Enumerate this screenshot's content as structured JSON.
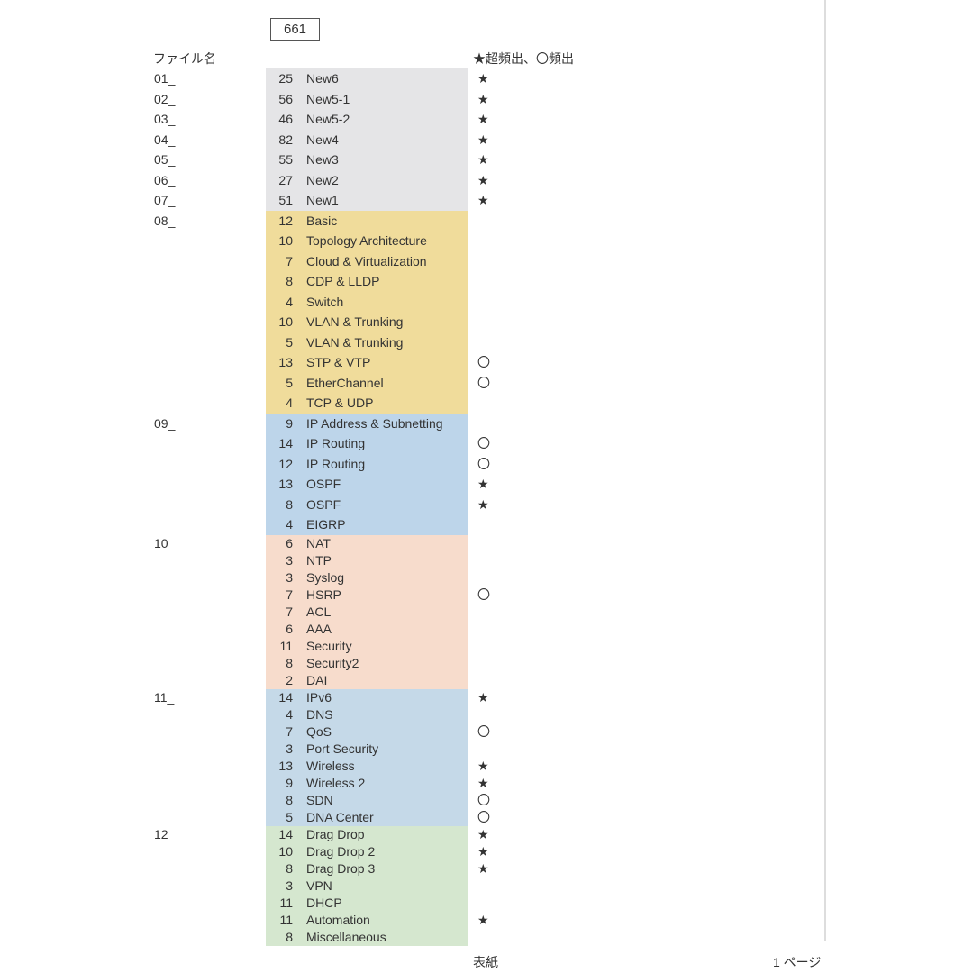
{
  "total": "661",
  "header": {
    "file": "ファイル名",
    "legend": "★超頻出、〇頻出"
  },
  "footer": {
    "center": "表紙",
    "right": "1 ページ"
  },
  "rows": [
    {
      "file": "01_",
      "count": 25,
      "topic": "New6",
      "mark": "★",
      "bg": "gray"
    },
    {
      "file": "02_",
      "count": 56,
      "topic": "New5-1",
      "mark": "★",
      "bg": "gray"
    },
    {
      "file": "03_",
      "count": 46,
      "topic": "New5-2",
      "mark": "★",
      "bg": "gray"
    },
    {
      "file": "04_",
      "count": 82,
      "topic": "New4",
      "mark": "★",
      "bg": "gray"
    },
    {
      "file": "05_",
      "count": 55,
      "topic": "New3",
      "mark": "★",
      "bg": "gray"
    },
    {
      "file": "06_",
      "count": 27,
      "topic": "New2",
      "mark": "★",
      "bg": "gray"
    },
    {
      "file": "07_",
      "count": 51,
      "topic": "New1",
      "mark": "★",
      "bg": "gray"
    },
    {
      "file": "08_",
      "count": 12,
      "topic": "Basic",
      "mark": "",
      "bg": "yellow"
    },
    {
      "file": "",
      "count": 10,
      "topic": "Topology Architecture",
      "mark": "",
      "bg": "yellow"
    },
    {
      "file": "",
      "count": 7,
      "topic": "Cloud & Virtualization",
      "mark": "",
      "bg": "yellow"
    },
    {
      "file": "",
      "count": 8,
      "topic": "CDP & LLDP",
      "mark": "",
      "bg": "yellow"
    },
    {
      "file": "",
      "count": 4,
      "topic": "Switch",
      "mark": "",
      "bg": "yellow"
    },
    {
      "file": "",
      "count": 10,
      "topic": "VLAN & Trunking",
      "mark": "",
      "bg": "yellow"
    },
    {
      "file": "",
      "count": 5,
      "topic": "VLAN & Trunking",
      "mark": "",
      "bg": "yellow"
    },
    {
      "file": "",
      "count": 13,
      "topic": "STP & VTP",
      "mark": "〇",
      "bg": "yellow"
    },
    {
      "file": "",
      "count": 5,
      "topic": "EtherChannel",
      "mark": "〇",
      "bg": "yellow"
    },
    {
      "file": "",
      "count": 4,
      "topic": "TCP & UDP",
      "mark": "",
      "bg": "yellow"
    },
    {
      "file": "09_",
      "count": 9,
      "topic": "IP Address & Subnetting",
      "mark": "",
      "bg": "blue"
    },
    {
      "file": "",
      "count": 14,
      "topic": "IP Routing",
      "mark": "〇",
      "bg": "blue"
    },
    {
      "file": "",
      "count": 12,
      "topic": "IP Routing",
      "mark": "〇",
      "bg": "blue"
    },
    {
      "file": "",
      "count": 13,
      "topic": "OSPF",
      "mark": "★",
      "bg": "blue"
    },
    {
      "file": "",
      "count": 8,
      "topic": "OSPF",
      "mark": "★",
      "bg": "blue"
    },
    {
      "file": "",
      "count": 4,
      "topic": "EIGRP",
      "mark": "",
      "bg": "blue"
    },
    {
      "file": "10_",
      "count": 6,
      "topic": "NAT",
      "mark": "",
      "bg": "peach",
      "compact": true
    },
    {
      "file": "",
      "count": 3,
      "topic": "NTP",
      "mark": "",
      "bg": "peach",
      "compact": true
    },
    {
      "file": "",
      "count": 3,
      "topic": "Syslog",
      "mark": "",
      "bg": "peach",
      "compact": true
    },
    {
      "file": "",
      "count": 7,
      "topic": "HSRP",
      "mark": "〇",
      "bg": "peach",
      "compact": true
    },
    {
      "file": "",
      "count": 7,
      "topic": "ACL",
      "mark": "",
      "bg": "peach",
      "compact": true
    },
    {
      "file": "",
      "count": 6,
      "topic": "AAA",
      "mark": "",
      "bg": "peach",
      "compact": true
    },
    {
      "file": "",
      "count": 11,
      "topic": "Security",
      "mark": "",
      "bg": "peach",
      "compact": true
    },
    {
      "file": "",
      "count": 8,
      "topic": "Security2",
      "mark": "",
      "bg": "peach",
      "compact": true
    },
    {
      "file": "",
      "count": 2,
      "topic": "DAI",
      "mark": "",
      "bg": "peach",
      "compact": true
    },
    {
      "file": "11_",
      "count": 14,
      "topic": "IPv6",
      "mark": "★",
      "bg": "blue2",
      "compact": true
    },
    {
      "file": "",
      "count": 4,
      "topic": "DNS",
      "mark": "",
      "bg": "blue2",
      "compact": true
    },
    {
      "file": "",
      "count": 7,
      "topic": "QoS",
      "mark": "〇",
      "bg": "blue2",
      "compact": true
    },
    {
      "file": "",
      "count": 3,
      "topic": "Port Security",
      "mark": "",
      "bg": "blue2",
      "compact": true
    },
    {
      "file": "",
      "count": 13,
      "topic": "Wireless",
      "mark": "★",
      "bg": "blue2",
      "compact": true
    },
    {
      "file": "",
      "count": 9,
      "topic": "Wireless 2",
      "mark": "★",
      "bg": "blue2",
      "compact": true
    },
    {
      "file": "",
      "count": 8,
      "topic": "SDN",
      "mark": "〇",
      "bg": "blue2",
      "compact": true
    },
    {
      "file": "",
      "count": 5,
      "topic": "DNA Center",
      "mark": "〇",
      "bg": "blue2",
      "compact": true
    },
    {
      "file": "12_",
      "count": 14,
      "topic": "Drag Drop",
      "mark": "★",
      "bg": "green",
      "compact": true
    },
    {
      "file": "",
      "count": 10,
      "topic": "Drag Drop 2",
      "mark": "★",
      "bg": "green",
      "compact": true
    },
    {
      "file": "",
      "count": 8,
      "topic": "Drag Drop 3",
      "mark": "★",
      "bg": "green",
      "compact": true
    },
    {
      "file": "",
      "count": 3,
      "topic": "VPN",
      "mark": "",
      "bg": "green",
      "compact": true
    },
    {
      "file": "",
      "count": 11,
      "topic": "DHCP",
      "mark": "",
      "bg": "green",
      "compact": true
    },
    {
      "file": "",
      "count": 11,
      "topic": "Automation",
      "mark": "★",
      "bg": "green",
      "compact": true
    },
    {
      "file": "",
      "count": 8,
      "topic": "Miscellaneous",
      "mark": "",
      "bg": "green",
      "compact": true
    }
  ]
}
